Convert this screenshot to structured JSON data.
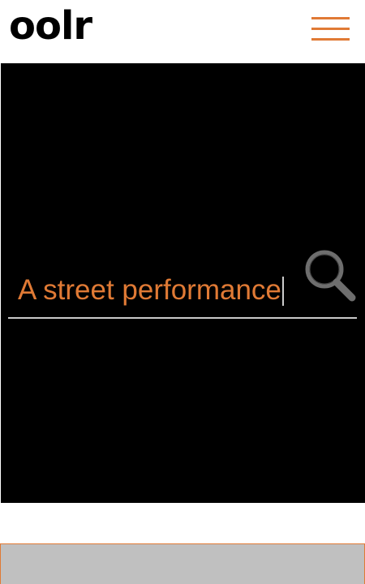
{
  "header": {
    "logo_text": "oolr",
    "menu_icon": "hamburger-menu-icon"
  },
  "search": {
    "value": "A street performance",
    "icon": "search-icon"
  },
  "colors": {
    "accent": "#e07a35",
    "hero_background": "#000000",
    "bottom_panel": "#c0c0c0"
  }
}
